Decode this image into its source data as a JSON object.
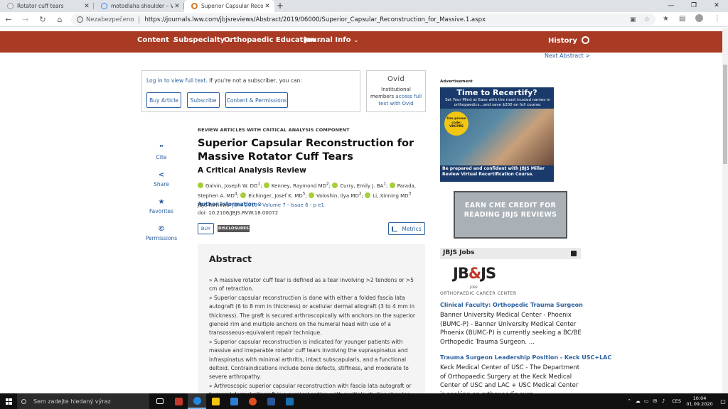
{
  "browser": {
    "tabs": [
      {
        "title": "Rotator cuff tears",
        "close": "✕"
      },
      {
        "title": "motodlaha shoulder – Vyhledáv…",
        "close": "✕"
      },
      {
        "title": "Superior Capsular Reconstructio…",
        "close": "✕"
      }
    ],
    "new_tab": "+",
    "window_controls": {
      "minimize": "—",
      "maximize": "❐",
      "close": "✕"
    },
    "nav": {
      "back": "←",
      "forward": "→",
      "reload": "↻",
      "home": "⌂"
    },
    "security_label": "Nezabezpečeno",
    "url": "https://journals.lww.com/jbjsreviews/Abstract/2019/06000/Superior_Capsular_Reconstruction_for_Massive.1.aspx"
  },
  "site_nav": {
    "items": [
      "Content",
      "Subspecialty",
      "Orthopaedic Education",
      "Journal Info"
    ],
    "history": "History",
    "caret": "⌄"
  },
  "next_abstract": "Next Abstract >",
  "access": {
    "login_link": "Log in to view full text.",
    "message": " If you're not a subscriber, you can:",
    "buttons": [
      "Buy Article",
      "Subscribe",
      "Content & Permissions"
    ]
  },
  "ovid": {
    "logo": "Ovid",
    "line_prefix": "Institutional members ",
    "link": "access full text with Ovid"
  },
  "tools": [
    {
      "icon": "”",
      "label": "Cite"
    },
    {
      "icon": "<",
      "label": "Share"
    },
    {
      "icon": "★",
      "label": "Favorites"
    },
    {
      "icon": "©",
      "label": "Permissions"
    }
  ],
  "article": {
    "kicker": "REVIEW ARTICLES WITH CRITICAL ANALYSIS COMPONENT",
    "title": "Superior Capsular Reconstruction for Massive Rotator Cuff Tears",
    "subtitle": "A Critical Analysis Review",
    "authors": [
      "Galvin, Joseph W. DO",
      "Kenney, Raymond MD",
      "Curry, Emily J. BA",
      "Parada, Stephen A. MD",
      "Eichinger, Josef K. MD",
      "Voloshin, Ilya MD",
      "Li, Xinning MD"
    ],
    "author_sups": [
      "1",
      "2",
      "1",
      "4",
      "5",
      "2",
      "3"
    ],
    "author_info": "Author Information ⊙",
    "journal_prefix": "JBJS Reviews: ",
    "journal_link": "June 2019 - Volume 7 - Issue 6 - p e1",
    "doi": "doi: 10.2106/JBJS.RVW.18.00072",
    "buy": "BUY",
    "disclosures": "DISCLOSURES",
    "metrics": "Metrics"
  },
  "abstract": {
    "heading": "Abstract",
    "points": [
      "» A massive rotator cuff tear is defined as a tear involving >2 tendons or >5 cm of retraction.",
      "» Superior capsular reconstruction is done with either a folded fascia lata autograft (6 to 8 mm in thickness) or acellular dermal allograft (3 to 4 mm in thickness). The graft is secured arthroscopically with anchors on the superior glenoid rim and multiple anchors on the humeral head with use of a transosseous-equivalent repair technique.",
      "» Superior capsular reconstruction is indicated for younger patients with massive and irreparable rotator cuff tears involving the supraspinatus and infraspinatus with minimal arthritis, intact subscapularis, and a functional deltoid. Contraindications include bone defects, stiffness, and moderate to severe arthropathy.",
      "» Arthroscopic superior capsular reconstruction with fascia lata autograft or humeral dermal allograft is a surgical option, with multiple studies showing statistically significant improvement in short-term outcomes for both pain and function among"
    ]
  },
  "ads": {
    "label": "Advertisement",
    "ad1_headline": "Time to Recertify?",
    "ad1_sub": "Set Your Mind at Ease with the most trusted names in orthopaedics…and save $200 on full course.",
    "ad1_badge": "Use promo code: VRCPRE",
    "ad1_footer": "Be prepared and confident with JBJS Miller Review Virtual Recertification Course.",
    "ad2_text": "EARN CME CREDIT FOR READING JBJS REVIEWS"
  },
  "jobs": {
    "header": "JBJS Jobs",
    "logo": {
      "a": "JB",
      "amp": "&",
      "b": "JS"
    },
    "logo_sub1": "JOBS",
    "logo_sub2": "ORTHOPAEDIC CAREER CENTER",
    "listings": [
      {
        "title": "Clinical Faculty: Orthopedic Trauma Surgeon",
        "desc": "Banner University Medical Center - Phoenix (BUMC-P) - Banner University Medical Center Phoenix (BUMC-P) is currently seeking a BC/BE Orthopedic Trauma Surgeon. ..."
      },
      {
        "title": "Trauma Surgeon Leadership Position - Keck USC+LAC",
        "desc": "Keck Medical Center of USC - The Department of Orthopaedic Surgery at the Keck Medical Center of USC and LAC + USC Medical Center is seeking an orthopaedic surg..."
      }
    ]
  },
  "taskbar": {
    "search_placeholder": "Sem zadejte hledaný výraz",
    "language": "CES",
    "time": "10:04",
    "date": "01.09.2020",
    "app_colors": [
      "#c0392b",
      "#1e88e5",
      "#f2c611",
      "#2d7dd2",
      "#e0501e",
      "#2b579a",
      "#1a6fb0"
    ],
    "tray_icons": [
      "⌃",
      "☁",
      "▭",
      "✉",
      "♪"
    ],
    "notifications": "▢"
  }
}
